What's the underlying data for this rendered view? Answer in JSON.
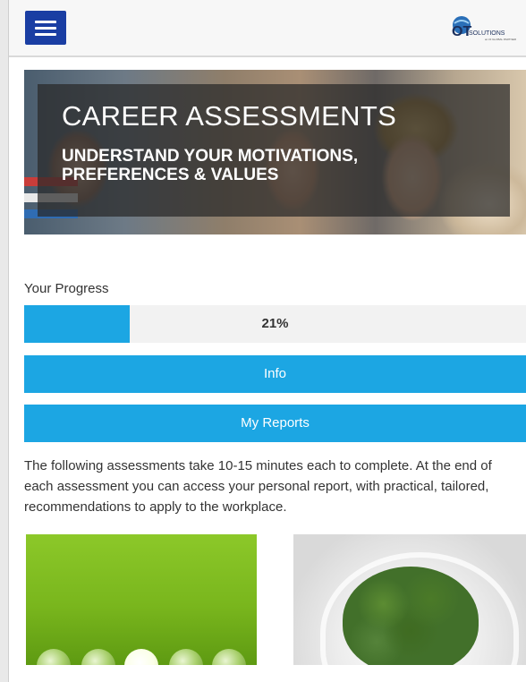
{
  "header": {
    "menu_icon": "hamburger-menu-icon",
    "logo": {
      "mark": "OT",
      "text": "SOLUTIONS",
      "tagline": "an OI GLOBAL PARTNER"
    },
    "accent_color": "#1a3ea3"
  },
  "hero": {
    "title": "CAREER ASSESSMENTS",
    "subtitle": "UNDERSTAND YOUR MOTIVATIONS, PREFERENCES & VALUES"
  },
  "progress": {
    "label": "Your Progress",
    "percent_text": "21%",
    "value_fraction": 0.21,
    "bar_color": "#1ca6e3"
  },
  "buttons": {
    "info": "Info",
    "reports": "My Reports",
    "color": "#1ca6e3"
  },
  "description": "The following assessments take 10-15 minutes each to complete. At the end of each assessment you can access your personal report, with practical, tailored, recommendations to apply to the workplace.",
  "cards": [
    {
      "image": "green-lightbulbs-image"
    },
    {
      "image": "tree-brain-head-image"
    }
  ]
}
